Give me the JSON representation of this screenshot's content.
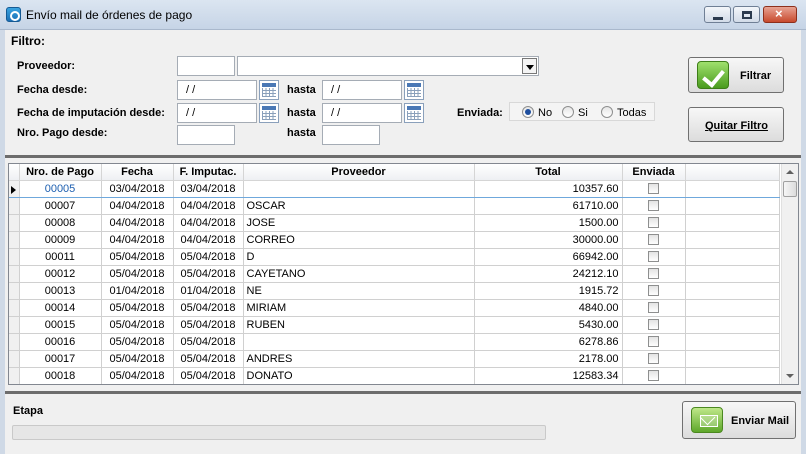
{
  "window": {
    "title": "Envío mail de órdenes de pago"
  },
  "filter": {
    "title": "Filtro:",
    "proveedor_label": "Proveedor:",
    "proveedor_code": "",
    "proveedor_name": "",
    "fecha_desde_label": "Fecha desde:",
    "fecha_desde": " / /",
    "hasta_label": "hasta",
    "fecha_hasta": " / /",
    "imput_desde_label": "Fecha de imputación desde:",
    "imput_desde": " / /",
    "imput_hasta": " / /",
    "nro_desde_label": "Nro. Pago desde:",
    "nro_desde": "",
    "nro_hasta": "",
    "enviada_label": "Enviada:",
    "enviada_options": [
      "No",
      "Si",
      "Todas"
    ],
    "enviada_selected": "No"
  },
  "buttons": {
    "filtrar": "Filtrar",
    "quitar_filtro": "Quitar Filtro",
    "enviar_mail": "Enviar Mail"
  },
  "table": {
    "columns": [
      "Nro. de Pago",
      "Fecha",
      "F. Imputac.",
      "Proveedor",
      "Total",
      "Enviada"
    ],
    "rows": [
      {
        "nro": "00005",
        "fecha": "03/04/2018",
        "imputac": "03/04/2018",
        "proveedor": "",
        "total": "10357.60",
        "enviada": false
      },
      {
        "nro": "00007",
        "fecha": "04/04/2018",
        "imputac": "04/04/2018",
        "proveedor": "OSCAR",
        "total": "61710.00",
        "enviada": false
      },
      {
        "nro": "00008",
        "fecha": "04/04/2018",
        "imputac": "04/04/2018",
        "proveedor": "JOSE",
        "total": "1500.00",
        "enviada": false
      },
      {
        "nro": "00009",
        "fecha": "04/04/2018",
        "imputac": "04/04/2018",
        "proveedor": "CORREO",
        "total": "30000.00",
        "enviada": false
      },
      {
        "nro": "00011",
        "fecha": "05/04/2018",
        "imputac": "05/04/2018",
        "proveedor": "D",
        "total": "66942.00",
        "enviada": false
      },
      {
        "nro": "00012",
        "fecha": "05/04/2018",
        "imputac": "05/04/2018",
        "proveedor": "CAYETANO",
        "total": "24212.10",
        "enviada": false
      },
      {
        "nro": "00013",
        "fecha": "01/04/2018",
        "imputac": "01/04/2018",
        "proveedor": "NE",
        "total": "1915.72",
        "enviada": false
      },
      {
        "nro": "00014",
        "fecha": "05/04/2018",
        "imputac": "05/04/2018",
        "proveedor": "MIRIAM",
        "total": "4840.00",
        "enviada": false
      },
      {
        "nro": "00015",
        "fecha": "05/04/2018",
        "imputac": "05/04/2018",
        "proveedor": "RUBEN",
        "total": "5430.00",
        "enviada": false
      },
      {
        "nro": "00016",
        "fecha": "05/04/2018",
        "imputac": "05/04/2018",
        "proveedor": "",
        "total": "6278.86",
        "enviada": false
      },
      {
        "nro": "00017",
        "fecha": "05/04/2018",
        "imputac": "05/04/2018",
        "proveedor": "ANDRES",
        "total": "2178.00",
        "enviada": false
      },
      {
        "nro": "00018",
        "fecha": "05/04/2018",
        "imputac": "05/04/2018",
        "proveedor": "DONATO",
        "total": "12583.34",
        "enviada": false
      }
    ]
  },
  "status": {
    "etapa_label": "Etapa",
    "progress": 0
  }
}
